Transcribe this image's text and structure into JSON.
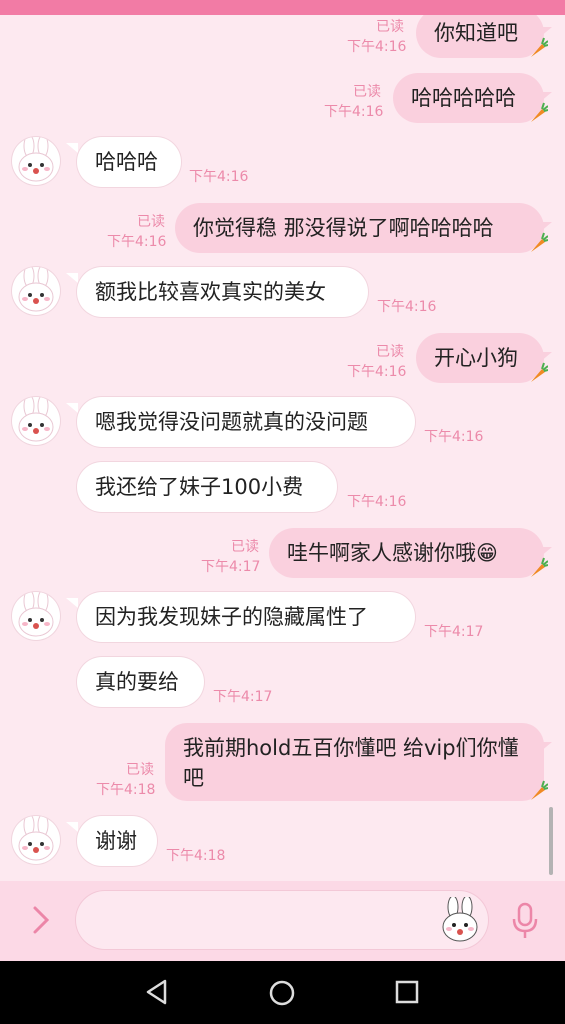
{
  "colors": {
    "accent": "#f27ba5",
    "background": "#fde9f0",
    "outgoing_bubble": "#fad0de",
    "incoming_bubble": "#ffffff",
    "meta_text": "#ec8aaa"
  },
  "messages": [
    {
      "dir": "out",
      "text": "你知道吧",
      "time": "下午4:16",
      "read": "已读"
    },
    {
      "dir": "out",
      "text": "哈哈哈哈哈",
      "time": "下午4:16",
      "read": "已读"
    },
    {
      "dir": "in",
      "text": "哈哈哈",
      "time": "下午4:16"
    },
    {
      "dir": "out",
      "text": "你觉得稳 那没得说了啊哈哈哈哈",
      "time": "下午4:16",
      "read": "已读"
    },
    {
      "dir": "in",
      "text": "额我比较喜欢真实的美女",
      "time": "下午4:16"
    },
    {
      "dir": "out",
      "text": "开心小狗",
      "time": "下午4:16",
      "read": "已读"
    },
    {
      "dir": "in",
      "text": "嗯我觉得没问题就真的没问题",
      "time": "下午4:16"
    },
    {
      "dir": "in",
      "text": "我还给了妹子100小费",
      "time": "下午4:16"
    },
    {
      "dir": "out",
      "text": "哇牛啊家人感谢你哦😁",
      "time": "下午4:17",
      "read": "已读"
    },
    {
      "dir": "in",
      "text": "因为我发现妹子的隐藏属性了",
      "time": "下午4:17"
    },
    {
      "dir": "in",
      "text": "真的要给",
      "time": "下午4:17"
    },
    {
      "dir": "out",
      "text": "我前期hold五百你懂吧 给vip们你懂吧",
      "time": "下午4:18",
      "read": "已读"
    },
    {
      "dir": "in",
      "text": "谢谢",
      "time": "下午4:18"
    }
  ],
  "icons": {
    "expand": "chevron-right-icon",
    "sticker": "bunny-sticker-icon",
    "voice": "microphone-icon",
    "avatar": "bunny-avatar-icon",
    "reaction": "carrot-icon",
    "nav_back": "nav-back-icon",
    "nav_home": "nav-home-icon",
    "nav_recents": "nav-recents-icon"
  },
  "input": {
    "value": "",
    "placeholder": ""
  }
}
